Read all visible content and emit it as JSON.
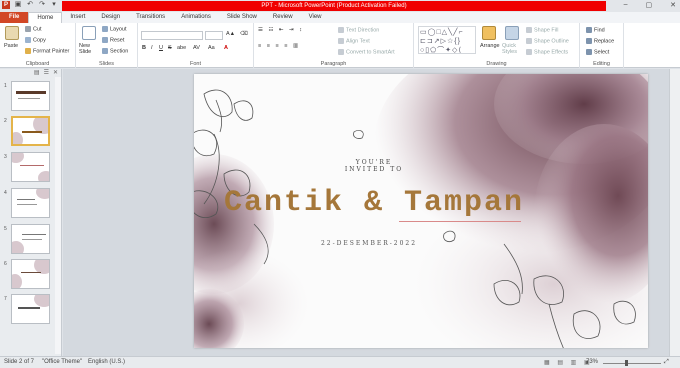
{
  "window": {
    "title": "PPT - Microsoft PowerPoint (Product Activation Failed)"
  },
  "tabs": [
    {
      "label": "File"
    },
    {
      "label": "Home"
    },
    {
      "label": "Insert"
    },
    {
      "label": "Design"
    },
    {
      "label": "Transitions"
    },
    {
      "label": "Animations"
    },
    {
      "label": "Slide Show"
    },
    {
      "label": "Review"
    },
    {
      "label": "View"
    }
  ],
  "ribbon": {
    "clipboard": {
      "label": "Clipboard",
      "paste": "Paste",
      "cut": "Cut",
      "copy": "Copy",
      "format_painter": "Format Painter"
    },
    "slides": {
      "label": "Slides",
      "new_slide": "New Slide",
      "layout": "Layout",
      "reset": "Reset",
      "section": "Section"
    },
    "font": {
      "label": "Font",
      "bold": "B",
      "italic": "I",
      "underline": "U",
      "strike": "S",
      "shadow": "abe",
      "spacing": "AV",
      "case": "Aa",
      "color": "A"
    },
    "paragraph": {
      "label": "Paragraph",
      "text_direction": "Text Direction",
      "align_text": "Align Text",
      "convert": "Convert to SmartArt"
    },
    "drawing": {
      "label": "Drawing",
      "arrange": "Arrange",
      "quick_styles": "Quick Styles",
      "shape_fill": "Shape Fill",
      "shape_outline": "Shape Outline",
      "shape_effects": "Shape Effects"
    },
    "editing": {
      "label": "Editing",
      "find": "Find",
      "replace": "Replace",
      "select": "Select"
    }
  },
  "slides_panel": {
    "slides": [
      {
        "num": "1"
      },
      {
        "num": "2"
      },
      {
        "num": "3"
      },
      {
        "num": "4"
      },
      {
        "num": "5"
      },
      {
        "num": "6"
      },
      {
        "num": "7"
      }
    ],
    "selected": "2"
  },
  "slide": {
    "invite_line1": "YOU'RE",
    "invite_line2": "INVITED TO",
    "title": "Cantik & Tampan",
    "date": "22-DESEMBER-2022"
  },
  "status": {
    "slide_info": "Slide 2 of 7",
    "theme": "\"Office Theme\"",
    "language": "English (U.S.)",
    "zoom": "73%"
  },
  "colors": {
    "accent": "#d24726",
    "title_bar": "#f00000",
    "title_text": "#a5773a"
  }
}
